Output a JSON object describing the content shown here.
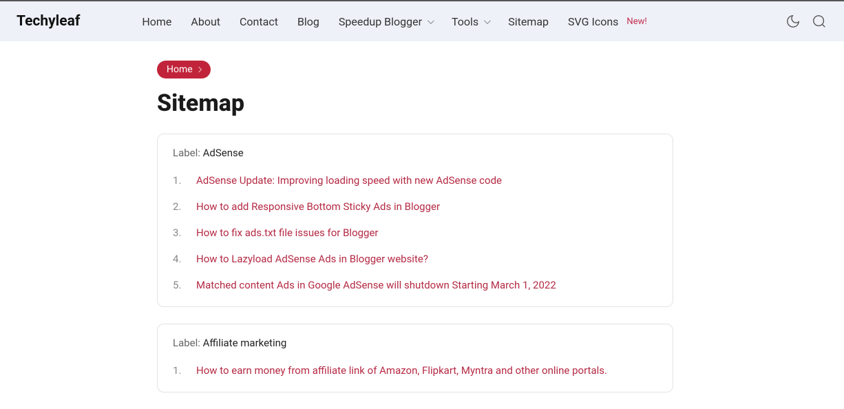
{
  "brand": "Techyleaf",
  "nav": {
    "home": "Home",
    "about": "About",
    "contact": "Contact",
    "blog": "Blog",
    "speedup": "Speedup Blogger",
    "tools": "Tools",
    "sitemap": "Sitemap",
    "svgicons": "SVG Icons",
    "new_badge": "New!"
  },
  "breadcrumb": {
    "home": "Home"
  },
  "page_title": "Sitemap",
  "sections": [
    {
      "label_prefix": "Label: ",
      "label": "AdSense",
      "items": [
        "AdSense Update: Improving loading speed with new AdSense code",
        "How to add Responsive Bottom Sticky Ads in Blogger",
        "How to fix ads.txt file issues for Blogger",
        "How to Lazyload AdSense Ads in Blogger website?",
        "Matched content Ads in Google AdSense will shutdown Starting March 1, 2022"
      ]
    },
    {
      "label_prefix": "Label: ",
      "label": "Affiliate marketing",
      "items": [
        "How to earn money from affiliate link of Amazon, Flipkart, Myntra and other online portals."
      ]
    }
  ]
}
